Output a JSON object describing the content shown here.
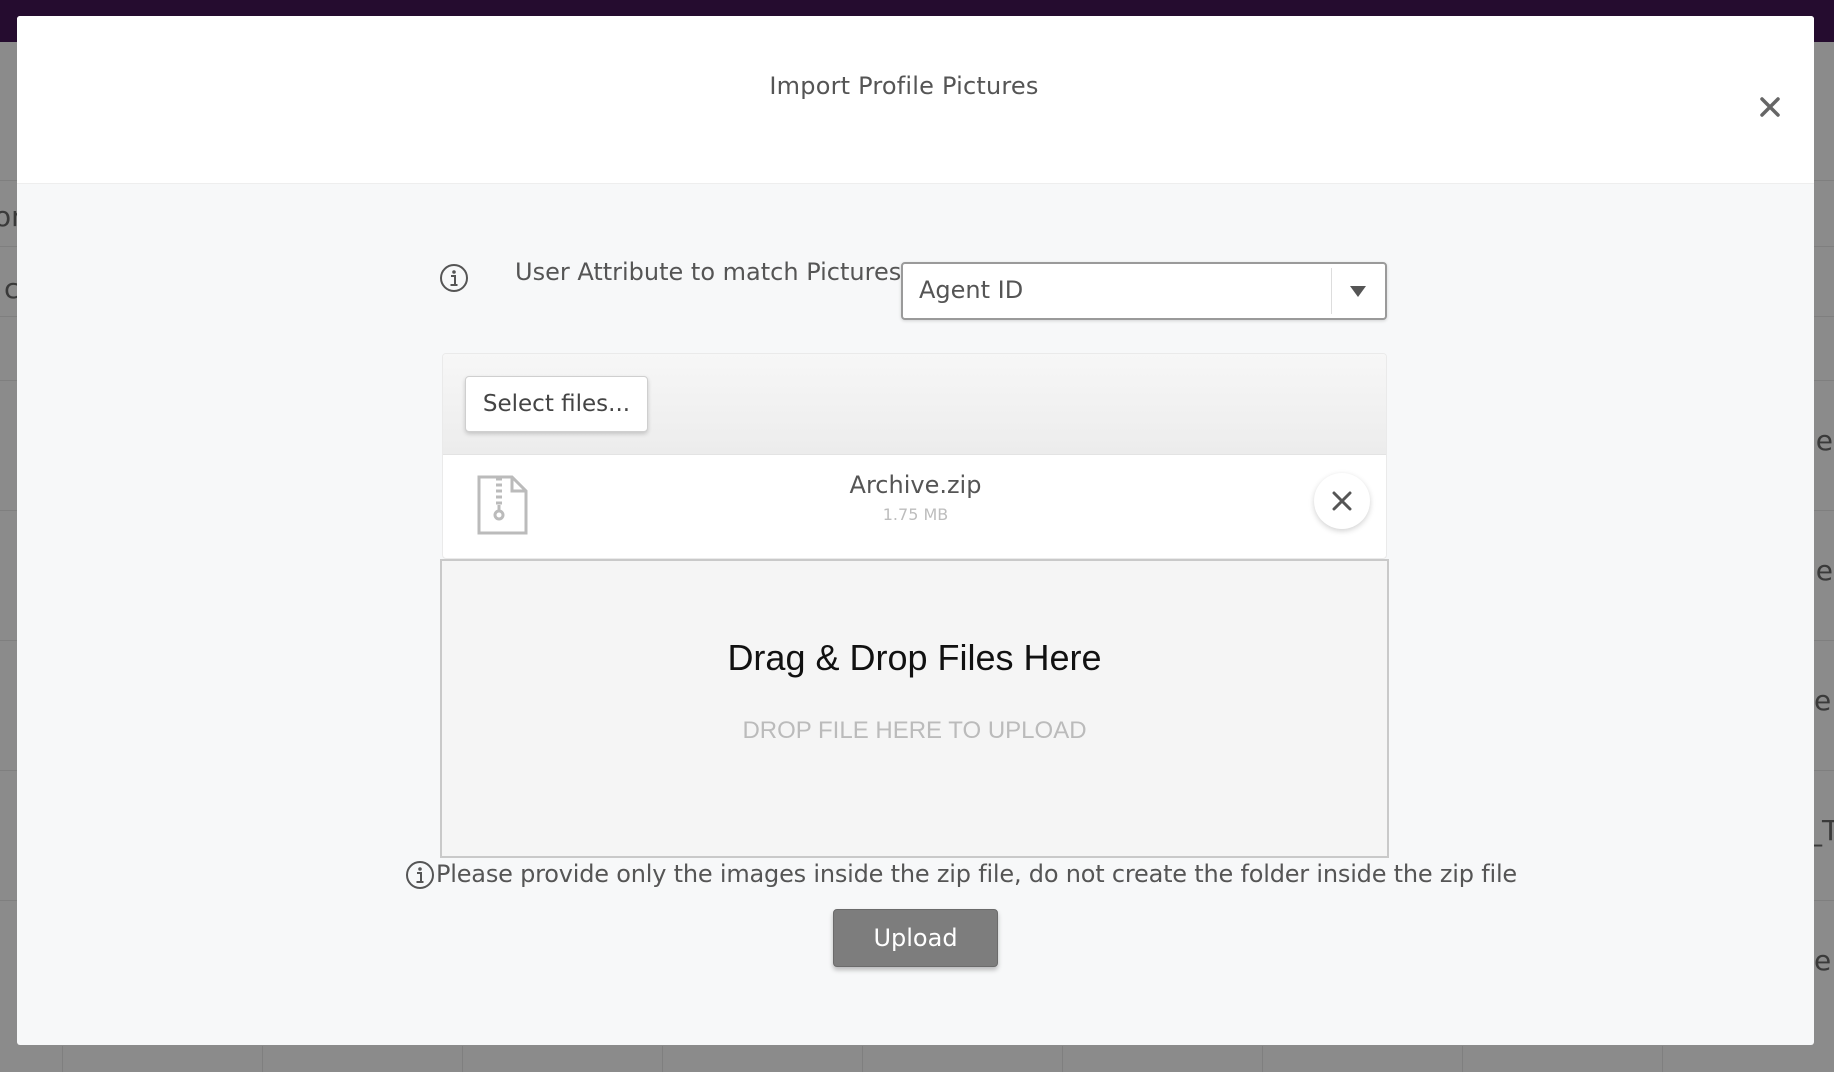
{
  "modal": {
    "title": "Import Profile Pictures"
  },
  "attribute": {
    "label": "User Attribute to match Pictures:",
    "selected": "Agent ID"
  },
  "upload": {
    "select_files_label": "Select files...",
    "file": {
      "name": "Archive.zip",
      "size": "1.75 MB"
    },
    "drop_title": "Drag & Drop Files Here",
    "drop_subtitle": "DROP FILE HERE TO UPLOAD"
  },
  "note": "Please provide only the images inside the zip file, do not create the folder inside the zip file",
  "upload_button_label": "Upload",
  "background_fragments": [
    "on",
    "c",
    "le",
    "le",
    "e",
    "_T",
    "e"
  ],
  "icons": {
    "close": "close-icon",
    "info": "info-icon",
    "dropdown": "caret-down-icon",
    "file": "zip-file-icon",
    "remove": "remove-file-icon"
  },
  "colors": {
    "topbar": "#250c2f",
    "upload_button": "#7d7d7d"
  }
}
